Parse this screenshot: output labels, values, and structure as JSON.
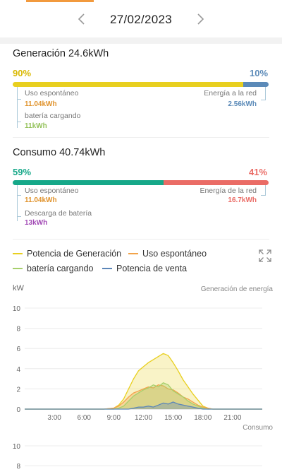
{
  "header": {
    "date": "27/02/2023"
  },
  "generation": {
    "title": "Generación 24.6kWh",
    "left_pct": "90%",
    "right_pct": "10%",
    "left_fraction": 0.9,
    "self_use_label": "Uso espontáneo",
    "self_use_value": "11.04kWh",
    "battery_label": "batería cargando",
    "battery_value": "11kWh",
    "grid_label": "Energía a la red",
    "grid_value": "2.56kWh"
  },
  "consumption": {
    "title": "Consumo 40.74kWh",
    "left_pct": "59%",
    "right_pct": "41%",
    "left_fraction": 0.59,
    "self_use_label": "Uso espontáneo",
    "self_use_value": "11.04kWh",
    "discharge_label": "Descarga de batería",
    "discharge_value": "13kWh",
    "grid_label": "Energía de la red",
    "grid_value": "16.7kWh"
  },
  "legend": {
    "generation": "Potencia de Generación",
    "self_use": "Uso espontáneo",
    "battery": "batería cargando",
    "sale": "Potencia de venta"
  },
  "colors": {
    "generation": "#e8cf1f",
    "self_use": "#f2a34a",
    "battery": "#a6cf6b",
    "sale": "#5b86b8",
    "consumption_green": "#16a889",
    "grid_red": "#ea6c66",
    "discharge_purple": "#a24ab5",
    "grid_blue": "#5b8ab8"
  },
  "chart_labels": {
    "unit": "kW",
    "right_title": "Generación de energía",
    "second_title": "Consumo"
  },
  "chart_data": {
    "type": "area",
    "ylabel": "kW",
    "ylim": [
      0,
      10
    ],
    "yticks": [
      0,
      2,
      4,
      6,
      8,
      10
    ],
    "xticks": [
      "3:00",
      "6:00",
      "9:00",
      "12:00",
      "15:00",
      "18:00",
      "21:00"
    ],
    "x_hours": [
      0,
      8,
      9,
      9.5,
      10,
      10.5,
      11,
      11.5,
      12,
      12.5,
      13,
      13.5,
      14,
      14.5,
      15,
      15.5,
      16,
      16.5,
      17,
      17.5,
      18,
      18.5,
      19,
      24
    ],
    "series": [
      {
        "name": "Potencia de Generación",
        "values": [
          0,
          0,
          0.1,
          0.4,
          1.0,
          2.0,
          3.0,
          3.8,
          4.2,
          4.6,
          4.9,
          5.2,
          5.5,
          5.3,
          4.6,
          3.8,
          2.9,
          2.2,
          1.5,
          0.9,
          0.3,
          0.1,
          0,
          0
        ]
      },
      {
        "name": "Uso espontáneo",
        "values": [
          0,
          0,
          0.1,
          0.3,
          0.7,
          1.2,
          1.6,
          1.8,
          2.0,
          2.2,
          2.1,
          2.4,
          2.3,
          2.0,
          1.9,
          1.6,
          1.2,
          1.0,
          0.7,
          0.4,
          0.2,
          0.1,
          0,
          0
        ]
      },
      {
        "name": "batería cargando",
        "values": [
          0,
          0,
          0,
          0.1,
          0.3,
          0.8,
          1.3,
          1.6,
          1.9,
          2.1,
          2.4,
          2.2,
          2.6,
          2.4,
          1.8,
          1.5,
          1.2,
          0.8,
          0.5,
          0.3,
          0.1,
          0,
          0,
          0
        ]
      },
      {
        "name": "Potencia de venta",
        "values": [
          0,
          0,
          0,
          0,
          0,
          0,
          0.1,
          0.2,
          0.2,
          0.3,
          0.2,
          0.4,
          0.6,
          0.5,
          0.7,
          0.5,
          0.4,
          0.3,
          0.2,
          0.1,
          0,
          0,
          0,
          0
        ]
      }
    ],
    "second_chart_visible_yticks": [
      8,
      10
    ]
  }
}
